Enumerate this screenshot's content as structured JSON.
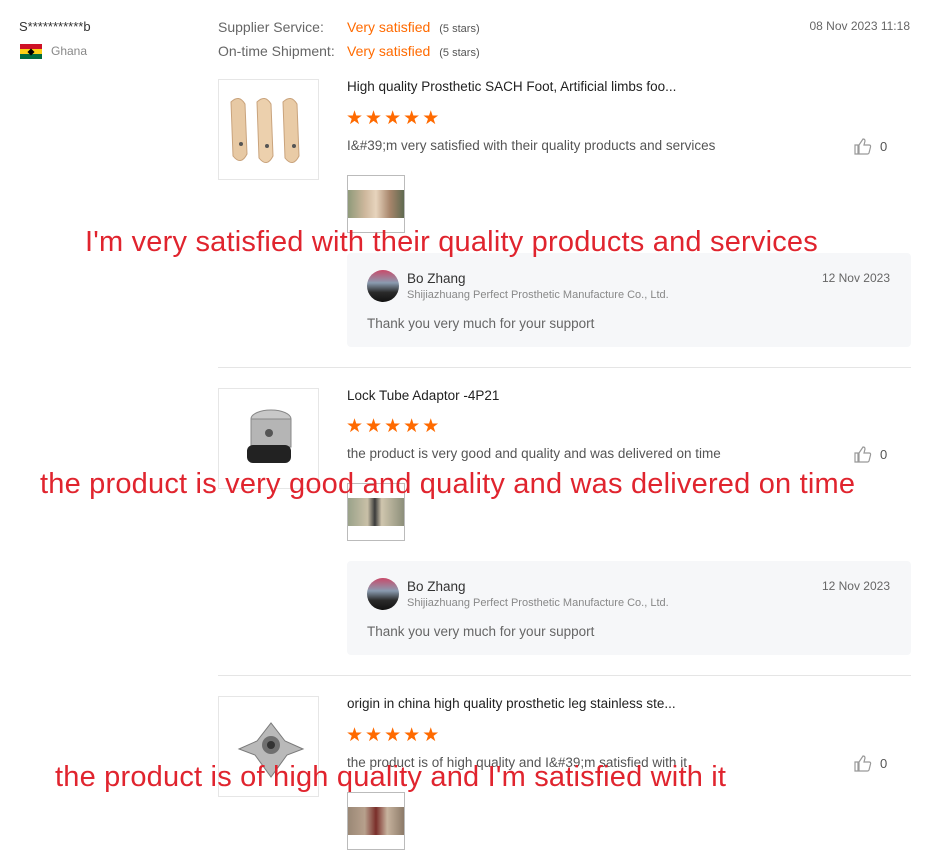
{
  "reviewer": {
    "name": "S***********b",
    "country": "Ghana"
  },
  "ratings": [
    {
      "label": "Supplier Service:",
      "value": "Very satisfied",
      "count": "(5 stars)"
    },
    {
      "label": "On-time Shipment:",
      "value": "Very satisfied",
      "count": "(5 stars)"
    }
  ],
  "review_date": "08 Nov 2023 11:18",
  "products": [
    {
      "title": "High quality Prosthetic SACH Foot, Artificial limbs foo...",
      "stars": 5,
      "text": "I&#39;m very satisfied with their quality products and services",
      "likes": "0",
      "reply": {
        "name": "Bo Zhang",
        "company": "Shijiazhuang Perfect Prosthetic Manufacture Co., Ltd.",
        "date": "12 Nov 2023",
        "text": "Thank you very much for your support"
      }
    },
    {
      "title": "Lock Tube Adaptor -4P21",
      "stars": 5,
      "text": "the product is very good and quality and was delivered on time",
      "likes": "0",
      "reply": {
        "name": "Bo Zhang",
        "company": "Shijiazhuang Perfect Prosthetic Manufacture Co., Ltd.",
        "date": "12 Nov 2023",
        "text": "Thank you very much for your support"
      }
    },
    {
      "title": "origin in china high quality prosthetic leg stainless ste...",
      "stars": 5,
      "text": "the product is of high quality and I&#39;m satisfied with it",
      "likes": "0"
    }
  ],
  "overlays": [
    "I'm very satisfied with their quality products and services",
    "the product is very good and quality and was delivered on time",
    "the product is of high quality and I'm satisfied with it"
  ],
  "colors": {
    "accent": "#ff6a00",
    "overlay": "#e0242e"
  }
}
